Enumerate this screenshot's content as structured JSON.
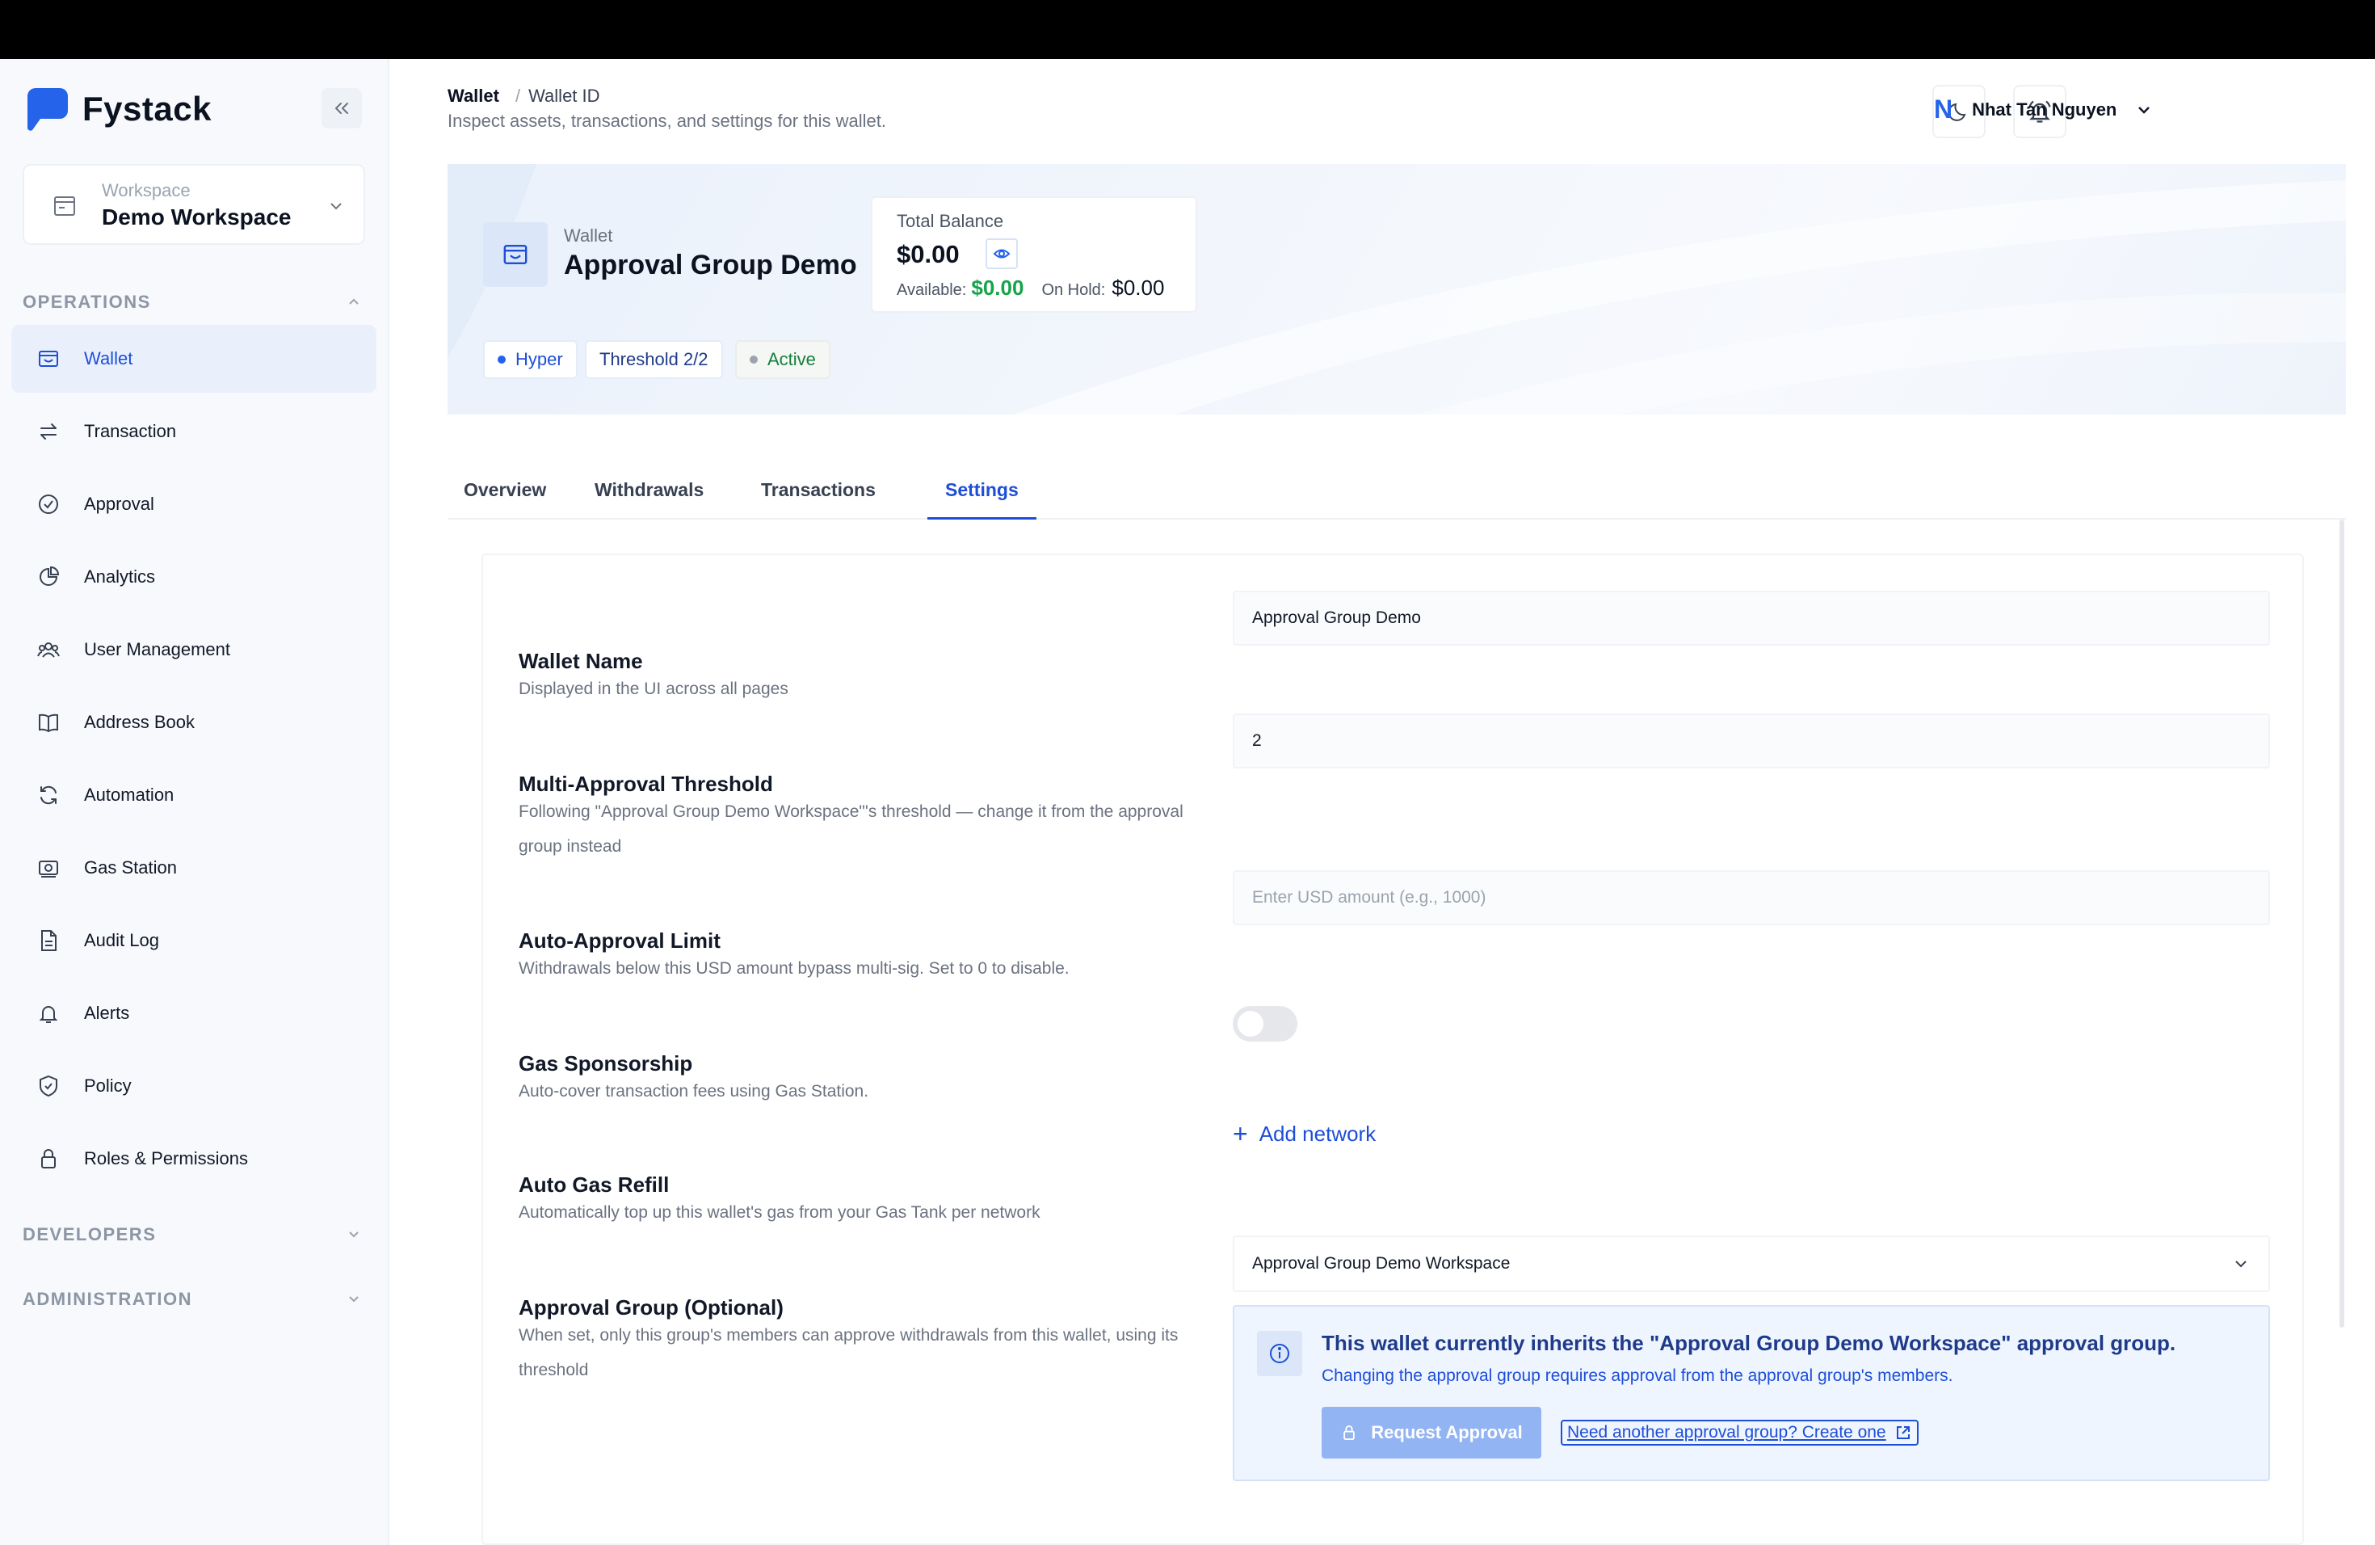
{
  "app": {
    "name": "Fystack"
  },
  "workspace": {
    "label": "Workspace",
    "name": "Demo Workspace"
  },
  "sidebar": {
    "operations_label": "OPERATIONS",
    "items": [
      {
        "label": "Wallet",
        "icon": "wallet-icon",
        "active": true
      },
      {
        "label": "Transaction",
        "icon": "arrows-icon"
      },
      {
        "label": "Approval",
        "icon": "check-circle-icon"
      },
      {
        "label": "Analytics",
        "icon": "pie-chart-icon"
      },
      {
        "label": "User Management",
        "icon": "users-icon"
      },
      {
        "label": "Address Book",
        "icon": "book-icon"
      },
      {
        "label": "Automation",
        "icon": "refresh-icon"
      },
      {
        "label": "Gas Station",
        "icon": "gas-icon"
      },
      {
        "label": "Audit Log",
        "icon": "document-icon"
      },
      {
        "label": "Alerts",
        "icon": "bell-icon"
      },
      {
        "label": "Policy",
        "icon": "shield-icon"
      },
      {
        "label": "Roles & Permissions",
        "icon": "lock-icon"
      }
    ],
    "developers_label": "DEVELOPERS",
    "administration_label": "ADMINISTRATION"
  },
  "header": {
    "breadcrumb": [
      "Wallet",
      "Wallet ID"
    ],
    "subtitle": "Inspect assets, transactions, and settings for this wallet.",
    "user": {
      "initial": "N",
      "name": "Nhat Tan Nguyen"
    }
  },
  "wallet": {
    "label": "Wallet",
    "name": "Approval Group Demo",
    "balance": {
      "label": "Total Balance",
      "total": "$0.00",
      "available_label": "Available:",
      "available": "$0.00",
      "on_hold_label": "On Hold:",
      "on_hold": "$0.00"
    },
    "badges": [
      {
        "text": "Hyper",
        "dot_color": "#2563eb"
      },
      {
        "text": "Threshold 2/2"
      },
      {
        "text": "Active",
        "dot_color": "#9ca3af"
      }
    ]
  },
  "tabs": [
    {
      "label": "Overview"
    },
    {
      "label": "Withdrawals"
    },
    {
      "label": "Transactions"
    },
    {
      "label": "Settings",
      "active": true
    }
  ],
  "settings": {
    "wallet_name": {
      "title": "Wallet Name",
      "desc": "Displayed in the UI across all pages",
      "value": "Approval Group Demo"
    },
    "threshold": {
      "title": "Multi-Approval Threshold",
      "desc": "Following \"Approval Group Demo Workspace\"'s threshold — change it from the approval group instead",
      "value": "2"
    },
    "auto_approval": {
      "title": "Auto-Approval Limit",
      "desc": "Withdrawals below this USD amount bypass multi-sig. Set to 0 to disable.",
      "placeholder": "Enter USD amount (e.g., 1000)"
    },
    "gas_sponsorship": {
      "title": "Gas Sponsorship",
      "desc": "Auto-cover transaction fees using Gas Station.",
      "enabled": false
    },
    "auto_gas_refill": {
      "title": "Auto Gas Refill",
      "desc": "Automatically top up this wallet's gas from your Gas Tank per network",
      "add_label": "Add network"
    },
    "approval_group": {
      "title": "Approval Group (Optional)",
      "desc": "When set, only this group's members can approve withdrawals from this wallet, using its threshold",
      "selected": "Approval Group Demo Workspace",
      "info_title": "This wallet currently inherits the \"Approval Group Demo Workspace\" approval group.",
      "info_text": "Changing the approval group requires approval from the approval group's members.",
      "request_label": "Request Approval",
      "create_label": "Need another approval group? Create one"
    }
  },
  "colors": {
    "accent": "#1d4ed8",
    "success": "#16a34a",
    "sidebar_bg": "#f7f9fc"
  }
}
